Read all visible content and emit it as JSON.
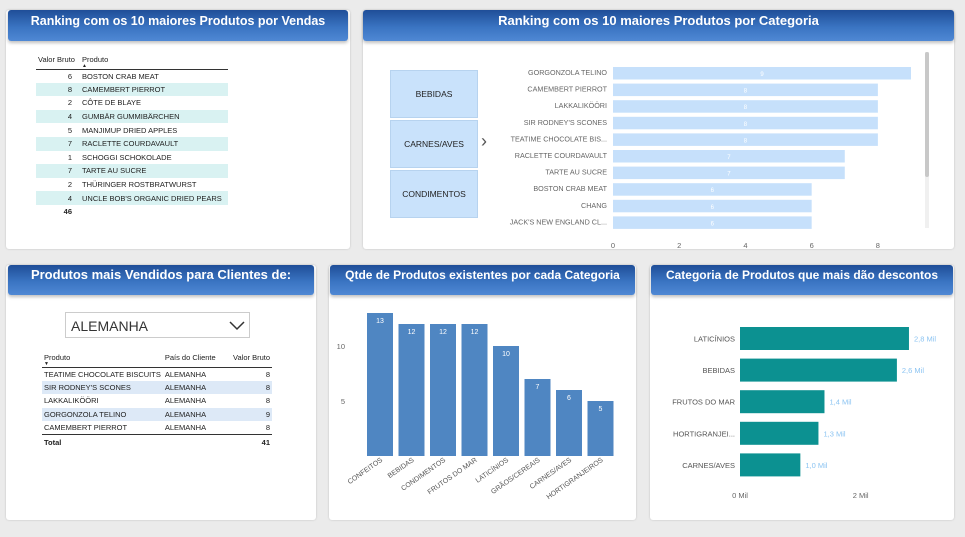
{
  "panels": {
    "vendas_title": "Ranking com os 10 maiores Produtos por Vendas",
    "categoria_title": "Ranking com os 10 maiores Produtos por Categoria",
    "clientes_title": "Produtos mais Vendidos para Clientes de:",
    "qtde_title": "Qtde de Produtos existentes por cada Categoria",
    "descontos_title": "Categoria de Produtos que mais dão descontos"
  },
  "vendas_table": {
    "col_valor": "Valor Bruto",
    "col_produto": "Produto",
    "rows": [
      {
        "valor": "6",
        "produto": "BOSTON CRAB MEAT"
      },
      {
        "valor": "8",
        "produto": "CAMEMBERT PIERROT"
      },
      {
        "valor": "2",
        "produto": "CÔTE DE BLAYE"
      },
      {
        "valor": "4",
        "produto": "GUMBÄR GUMMIBÄRCHEN"
      },
      {
        "valor": "5",
        "produto": "MANJIMUP DRIED APPLES"
      },
      {
        "valor": "7",
        "produto": "RACLETTE COURDAVAULT"
      },
      {
        "valor": "1",
        "produto": "SCHOGGI SCHOKOLADE"
      },
      {
        "valor": "7",
        "produto": "TARTE AU SUCRE"
      },
      {
        "valor": "2",
        "produto": "THÜRINGER ROSTBRATWURST"
      },
      {
        "valor": "4",
        "produto": "UNCLE BOB'S ORGANIC DRIED PEARS"
      }
    ],
    "total": "46"
  },
  "categoria_slicer": {
    "items": [
      "BEBIDAS",
      "CARNES/AVES",
      "CONDIMENTOS"
    ],
    "arrow": "›"
  },
  "clientes": {
    "dropdown_value": "ALEMANHA",
    "col_produto": "Produto",
    "col_pais": "País do Cliente",
    "col_valor": "Valor Bruto",
    "rows": [
      {
        "produto": "TEATIME CHOCOLATE BISCUITS",
        "pais": "ALEMANHA",
        "valor": "8"
      },
      {
        "produto": "SIR RODNEY'S SCONES",
        "pais": "ALEMANHA",
        "valor": "8"
      },
      {
        "produto": "LAKKALIKÖÖRI",
        "pais": "ALEMANHA",
        "valor": "8"
      },
      {
        "produto": "GORGONZOLA TELINO",
        "pais": "ALEMANHA",
        "valor": "9"
      },
      {
        "produto": "CAMEMBERT PIERROT",
        "pais": "ALEMANHA",
        "valor": "8"
      }
    ],
    "total_label": "Total",
    "total_value": "41"
  },
  "chart_data": [
    {
      "type": "bar",
      "orientation": "horizontal",
      "categories": [
        "GORGONZOLA TELINO",
        "CAMEMBERT PIERROT",
        "LAKKALIKÖÖRI",
        "SIR RODNEY'S SCONES",
        "TEATIME CHOCOLATE BIS...",
        "RACLETTE COURDAVAULT",
        "TARTE AU SUCRE",
        "BOSTON CRAB MEAT",
        "CHANG",
        "JACK'S NEW ENGLAND CL..."
      ],
      "values": [
        9,
        8,
        8,
        8,
        8,
        7,
        7,
        6,
        6,
        6
      ],
      "xlim": [
        0,
        9
      ],
      "xticks": [
        "0",
        "2",
        "4",
        "6",
        "8"
      ],
      "bar_color": "#c6e0fb",
      "label_color": "#ffffff"
    },
    {
      "type": "bar",
      "orientation": "vertical",
      "categories": [
        "CONFEITOS",
        "BEBIDAS",
        "CONDIMENTOS",
        "FRUTOS DO MAR",
        "LATICÍNIOS",
        "GRÃOS/CEREAIS",
        "CARNES/AVES",
        "HORTIGRANJEIROS"
      ],
      "values": [
        13,
        12,
        12,
        12,
        10,
        7,
        6,
        5
      ],
      "ylim": [
        0,
        14
      ],
      "yticks": [
        "5",
        "10"
      ],
      "bar_color": "#4f86c2"
    },
    {
      "type": "bar",
      "orientation": "horizontal",
      "categories": [
        "LATICÍNIOS",
        "BEBIDAS",
        "FRUTOS DO MAR",
        "HORTIGRANJEI...",
        "CARNES/AVES"
      ],
      "values": [
        2.8,
        2.6,
        1.4,
        1.3,
        1.0
      ],
      "labels": [
        "2,8 Mil",
        "2,6 Mil",
        "1,4 Mil",
        "1,3 Mil",
        "1,0 Mil"
      ],
      "xlim": [
        0,
        2.9
      ],
      "xticks": [
        "0 Mil",
        "2 Mil"
      ],
      "bar_color": "#0c9191",
      "label_color": "#8cc4f2"
    }
  ]
}
